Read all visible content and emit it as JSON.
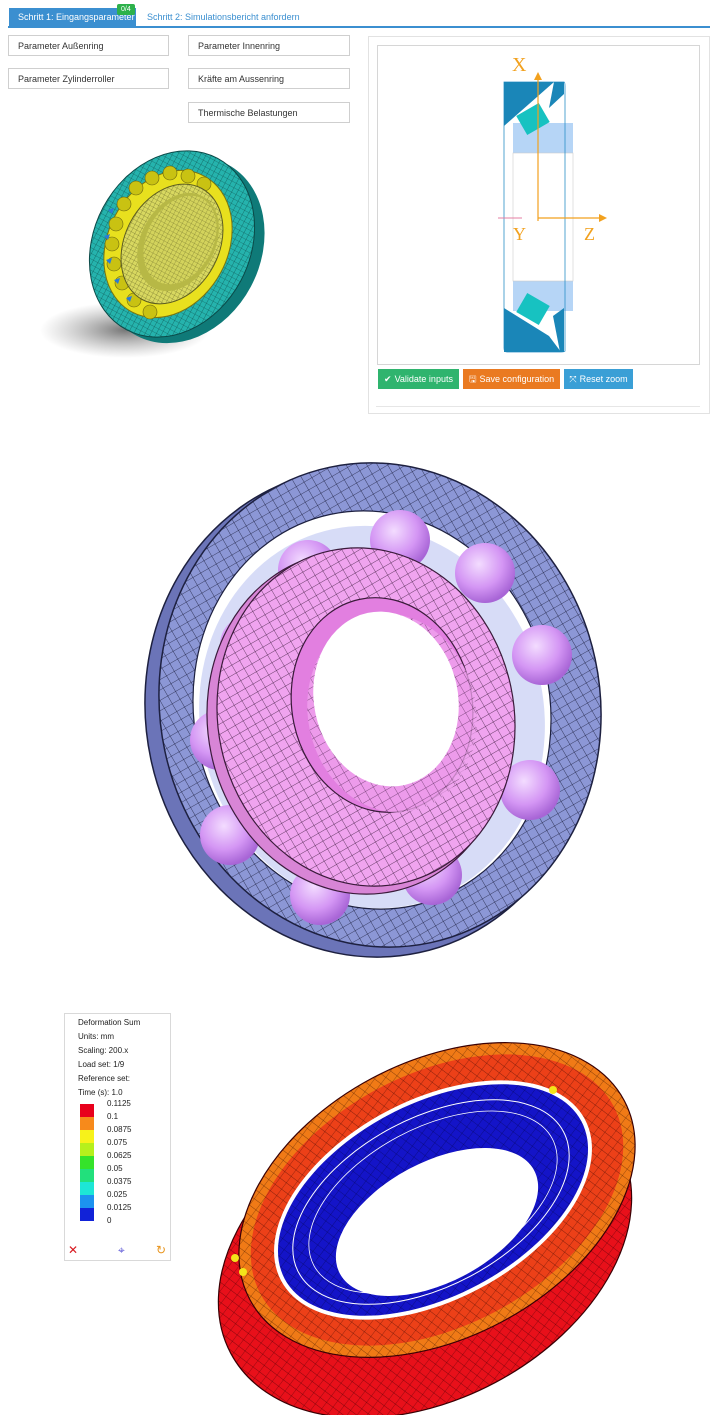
{
  "tabs": [
    {
      "label": "Schritt 1: Eingangsparameter",
      "badge": "0/4",
      "active": true
    },
    {
      "label": "Schritt 2: Simulationsbericht anfordern",
      "active": false
    }
  ],
  "parameters": {
    "outer_ring": "Parameter Außenring",
    "inner_ring": "Parameter Innenring",
    "roller": "Parameter Zylinderroller",
    "forces": "Kräfte am Aussenring",
    "thermal": "Thermische Belastungen"
  },
  "schematic": {
    "axis_x": "X",
    "axis_y": "Y",
    "axis_z": "Z",
    "accent_color": "#f2a11e"
  },
  "actions": {
    "validate": {
      "label": "Validate inputs",
      "icon": "check-icon",
      "color": "#2fb46e"
    },
    "save": {
      "label": "Save configuration",
      "icon": "floppy-disk-icon",
      "color": "#ea7a21"
    },
    "reset": {
      "label": "Reset zoom",
      "icon": "expand-arrows-icon",
      "color": "#3a9fd6"
    }
  },
  "legend": {
    "title": "Deformation Sum",
    "units": "Units: mm",
    "scaling": "Scaling: 200.x",
    "load_set": "Load set: 1/9",
    "reference_set": "Reference set:",
    "time": "Time (s): 1.0",
    "scale": [
      {
        "value": "0.1125",
        "color": "#e8001c"
      },
      {
        "value": "0.1",
        "color": "#f78a1b"
      },
      {
        "value": "0.0875",
        "color": "#f7f21a"
      },
      {
        "value": "0.075",
        "color": "#b6f01c"
      },
      {
        "value": "0.0625",
        "color": "#35e32a"
      },
      {
        "value": "0.05",
        "color": "#22e07c"
      },
      {
        "value": "0.0375",
        "color": "#1de6d6"
      },
      {
        "value": "0.025",
        "color": "#1c92ef"
      },
      {
        "value": "0.0125",
        "color": "#1122d8"
      },
      {
        "value": "0",
        "color": "#ffffff"
      }
    ],
    "tools": [
      {
        "icon": "close-icon",
        "color": "#d8191f"
      },
      {
        "icon": "crosshair-icon",
        "color": "#5a55d6"
      },
      {
        "icon": "rotate-icon",
        "color": "#e8941c"
      }
    ]
  }
}
